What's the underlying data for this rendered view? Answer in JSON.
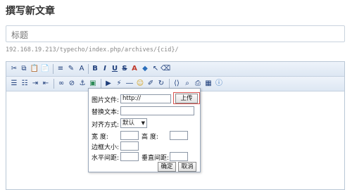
{
  "page": {
    "title": "撰写新文章"
  },
  "title_field": {
    "placeholder": "标题"
  },
  "url_text": "192.168.19.213/typecho/index.php/archives/{cid}/",
  "toolbar": {
    "row1": [
      "cut-icon",
      "copy-icon",
      "paste-icon",
      "paste-text-icon",
      "sep",
      "list-format-icon",
      "spellcheck-icon",
      "font-size-icon",
      "sep",
      "bold-icon",
      "italic-icon",
      "underline-icon",
      "strike-icon",
      "font-color-icon",
      "bg-color-icon",
      "select-icon",
      "clear-format-icon"
    ],
    "row2": [
      "align-left-icon",
      "list-icon",
      "indent-icon",
      "outdent-icon",
      "sep",
      "link-icon",
      "unlink-icon",
      "anchor-icon",
      "image-icon",
      "sep",
      "media-icon",
      "flash-icon",
      "hr-icon",
      "smiley-icon",
      "edit-icon",
      "redo-icon",
      "sep",
      "code-icon",
      "preview-icon",
      "print-icon",
      "template-icon",
      "about-icon"
    ],
    "labels": {
      "bold": "B",
      "italic": "I",
      "underline": "U",
      "strike": "S",
      "font_color": "A"
    }
  },
  "dialog": {
    "image_file_label": "图片文件:",
    "image_file_value": "http://",
    "upload_button": "上传",
    "alt_text_label": "替换文本:",
    "align_label": "对齐方式:",
    "align_value": "默认",
    "width_label": "宽      度:",
    "height_label": "高      度:",
    "border_label": "边框大小:",
    "hspace_label": "水平间距:",
    "vspace_label": "垂直间距:",
    "ok_button": "确定",
    "cancel_button": "取消"
  }
}
